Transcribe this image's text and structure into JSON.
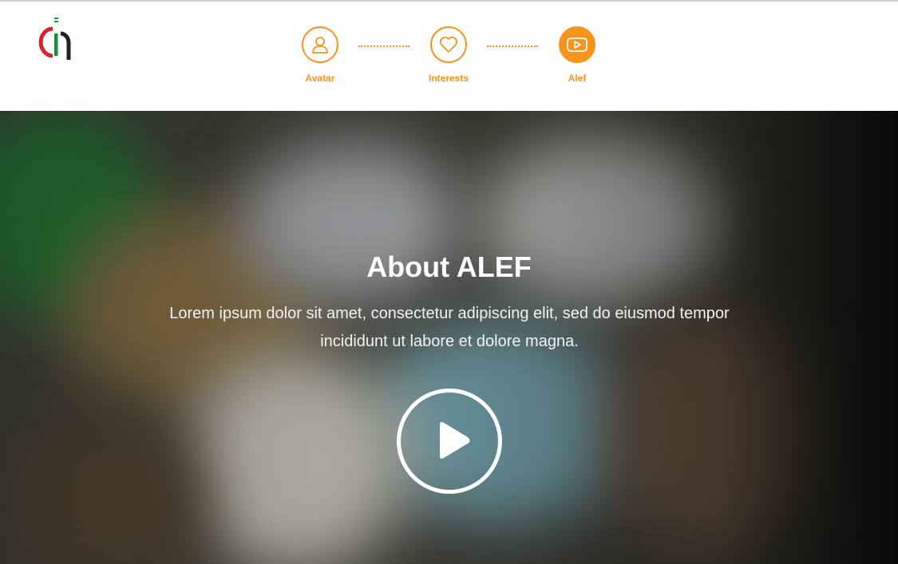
{
  "header": {
    "logo_icon": "alef-logo-icon",
    "steps": [
      {
        "label": "Avatar",
        "icon": "user-icon",
        "active": false
      },
      {
        "label": "Interests",
        "icon": "heart-icon",
        "active": false
      },
      {
        "label": "Alef",
        "icon": "video-play-icon",
        "active": true
      }
    ],
    "accent_color": "#f7941d"
  },
  "hero": {
    "title": "About ALEF",
    "text": "Lorem ipsum dolor sit amet, consectetur adipiscing elit, sed do eiusmod tempor incididunt ut labore et dolore magna.",
    "play_icon": "play-icon"
  }
}
